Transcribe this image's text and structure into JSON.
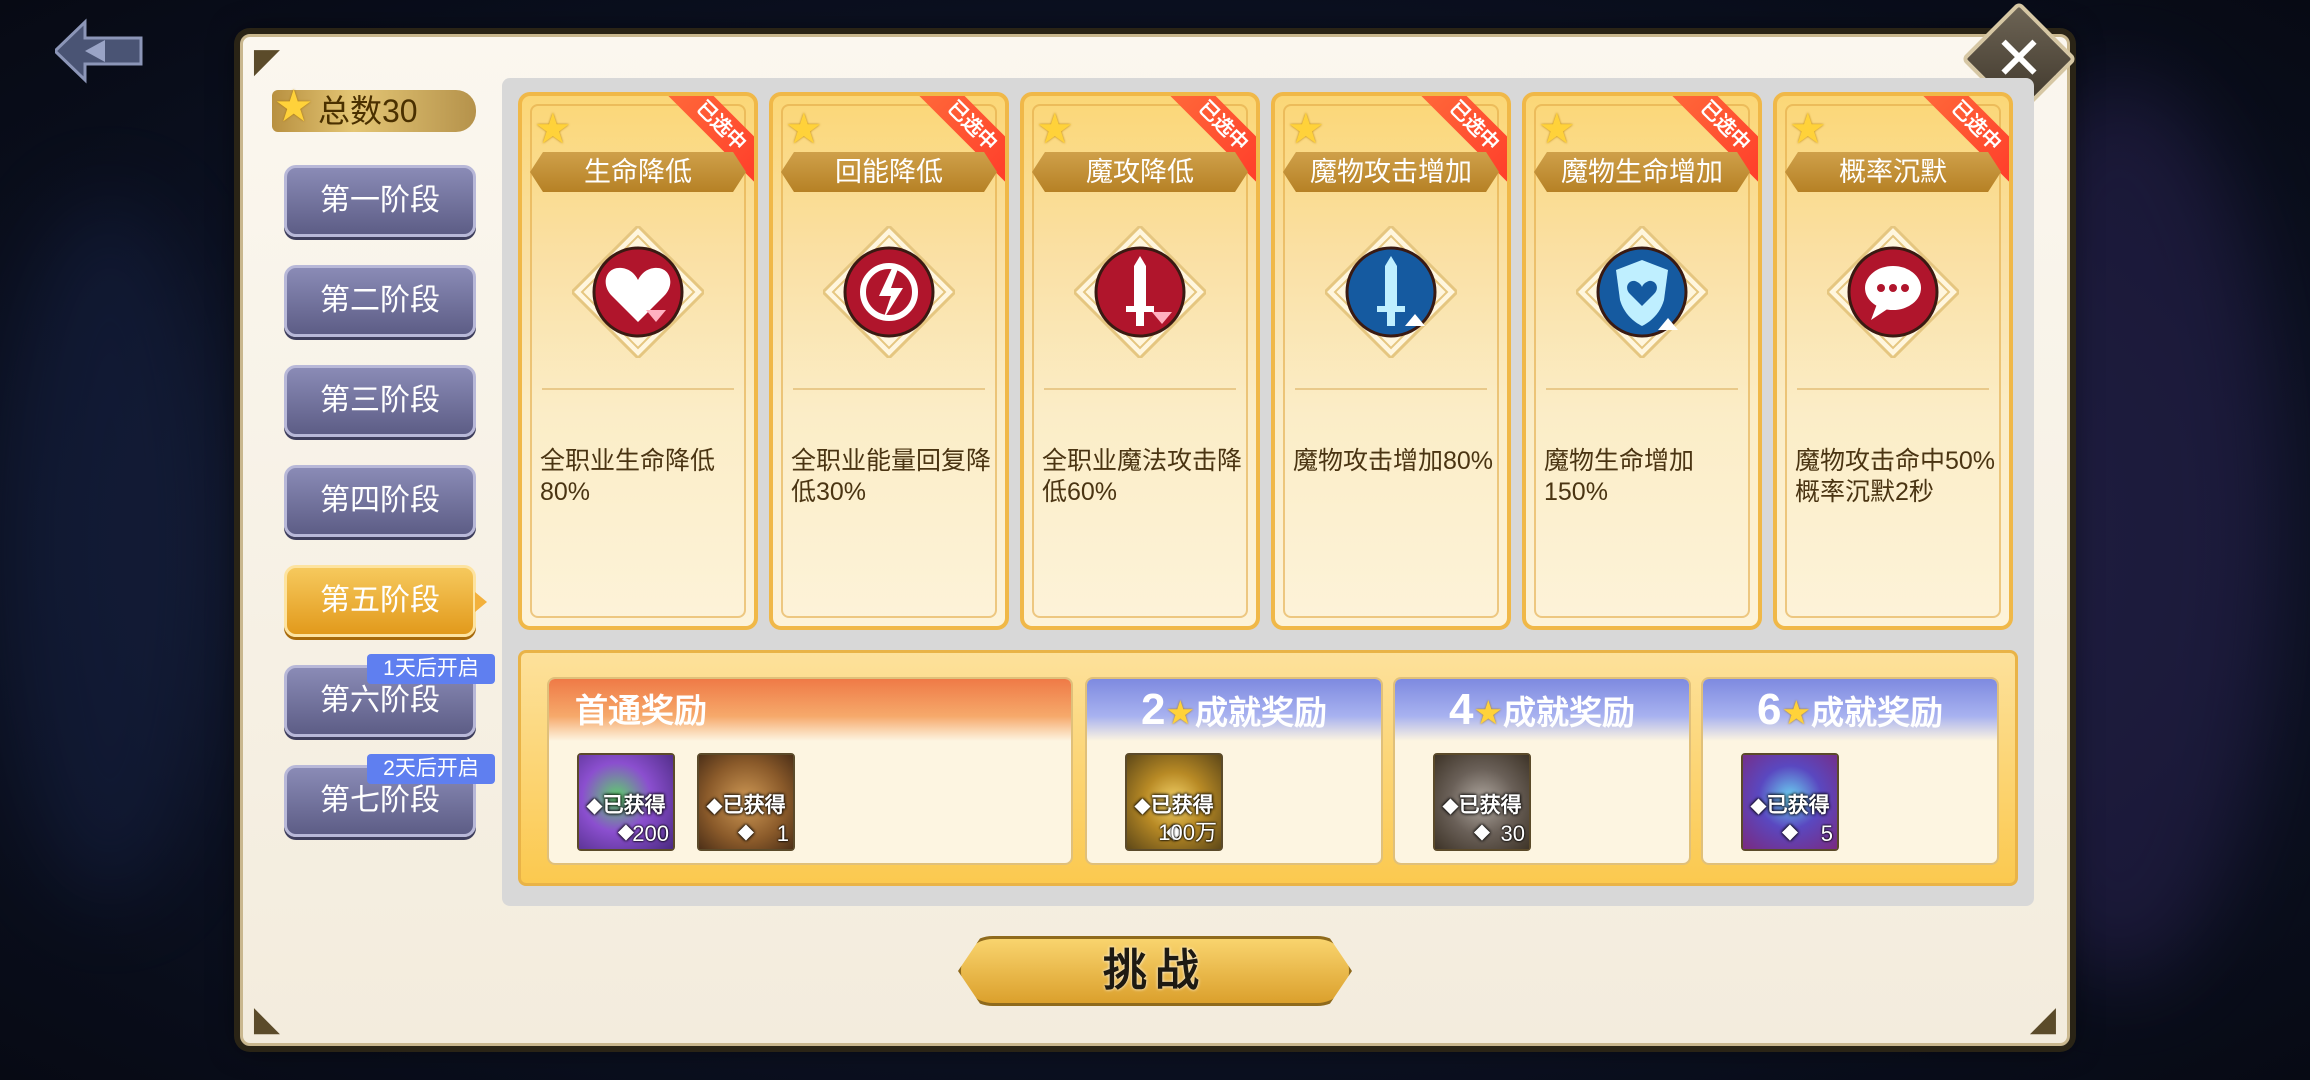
{
  "header": {
    "back_icon": "back-arrow-icon",
    "close_label": "✕"
  },
  "total": {
    "label": "总数30"
  },
  "stages": [
    {
      "label": "第一阶段",
      "active": false,
      "lock_text": ""
    },
    {
      "label": "第二阶段",
      "active": false,
      "lock_text": ""
    },
    {
      "label": "第三阶段",
      "active": false,
      "lock_text": ""
    },
    {
      "label": "第四阶段",
      "active": false,
      "lock_text": ""
    },
    {
      "label": "第五阶段",
      "active": true,
      "lock_text": ""
    },
    {
      "label": "第六阶段",
      "active": false,
      "lock_text": "1天后开启"
    },
    {
      "label": "第七阶段",
      "active": false,
      "lock_text": "2天后开启"
    }
  ],
  "cards": [
    {
      "name": "生命降低",
      "ribbon": "已选中",
      "desc": "全职业生命降低80%",
      "icon": "heart-down-icon",
      "color": "#b0152c"
    },
    {
      "name": "回能降低",
      "ribbon": "已选中",
      "desc": "全职业能量回复降低30%",
      "icon": "energy-down-icon",
      "color": "#b0152c"
    },
    {
      "name": "魔攻降低",
      "ribbon": "已选中",
      "desc": "全职业魔法攻击降低60%",
      "icon": "sword-down-icon",
      "color": "#b0152c"
    },
    {
      "name": "魔物攻击增加",
      "ribbon": "已选中",
      "desc": "魔物攻击增加80%",
      "icon": "sword-up-icon",
      "color": "#155aa0"
    },
    {
      "name": "魔物生命增加",
      "ribbon": "已选中",
      "desc": "魔物生命增加150%",
      "icon": "shield-up-icon",
      "color": "#155aa0"
    },
    {
      "name": "概率沉默",
      "ribbon": "已选中",
      "desc": "魔物攻击命中50%概率沉默2秒",
      "icon": "silence-bubble-icon",
      "color": "#b0152c"
    }
  ],
  "rewards": {
    "first": {
      "title": "首通奖励",
      "items": [
        {
          "status": "◆已获得◆",
          "qty": "200",
          "icon": "gem-cube-icon",
          "bg": "#6a3fa0"
        },
        {
          "status": "◆已获得◆",
          "qty": "1",
          "icon": "chest-icon",
          "bg": "#7a5632"
        }
      ]
    },
    "achievements": [
      {
        "stars": "2",
        "title": "成就奖励",
        "items": [
          {
            "status": "◆已获得◆",
            "qty": "100万",
            "icon": "gold-coin-icon",
            "bg": "#6b5524"
          }
        ]
      },
      {
        "stars": "4",
        "title": "成就奖励",
        "items": [
          {
            "status": "◆已获得◆",
            "qty": "30",
            "icon": "ore-stone-icon",
            "bg": "#5a4a30"
          }
        ]
      },
      {
        "stars": "6",
        "title": "成就奖励",
        "items": [
          {
            "status": "◆已获得◆",
            "qty": "5",
            "icon": "crystal-icon",
            "bg": "#4a3a90"
          }
        ]
      }
    ]
  },
  "challenge": {
    "label": "挑战"
  }
}
